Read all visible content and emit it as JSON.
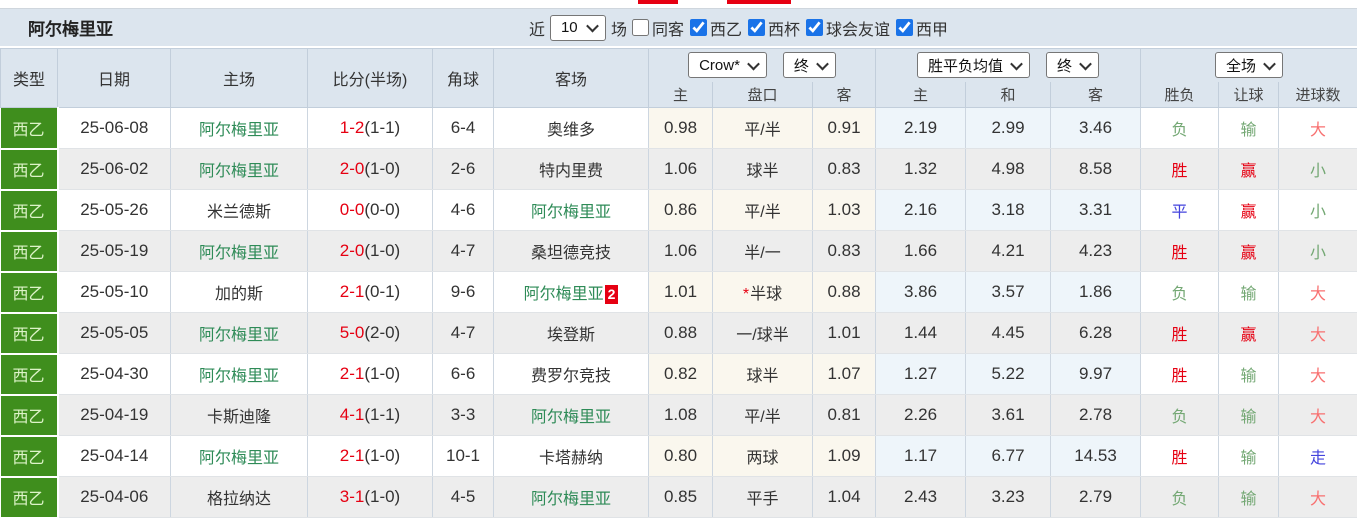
{
  "palette": {
    "strong-red": "#e60012",
    "light-red": "#f87070",
    "soft-green": "#74a874",
    "team-green": "#2e8b57",
    "blue": "#4343dd",
    "type-green": "#3f8e1d",
    "type-text": "#ddf3c8",
    "panel-bg": "#dce5ee",
    "cream": "#faf7ee",
    "lightblue": "#eef5fa",
    "stripe": "#ededed"
  },
  "header": {
    "team_title": "阿尔梅里亚"
  },
  "filter_bar": {
    "recent_label": "近",
    "recent_value": "10",
    "matches_label": "场",
    "checkboxes": [
      {
        "label": "同客",
        "checked": false
      },
      {
        "label": "西乙",
        "checked": true
      },
      {
        "label": "西杯",
        "checked": true
      },
      {
        "label": "球会友谊",
        "checked": true
      },
      {
        "label": "西甲",
        "checked": true
      }
    ]
  },
  "table": {
    "columns": [
      "类型",
      "日期",
      "主场",
      "比分(半场)",
      "角球",
      "客场"
    ],
    "selects": {
      "odds_company": "Crow*",
      "odds_time": "终",
      "avg_type": "胜平负均值",
      "avg_time": "终",
      "scope": "全场"
    },
    "sub_headers": [
      "主",
      "盘口",
      "客",
      "主",
      "和",
      "客",
      "胜负",
      "让球",
      "进球数"
    ],
    "rows": [
      {
        "type": "西乙",
        "date": "25-06-08",
        "home": "阿尔梅里亚",
        "home_team": true,
        "score": "1-2",
        "half": "(1-1)",
        "corner": "6-4",
        "away": "奥维多",
        "away_team": false,
        "away_badge": "",
        "o_home": "0.98",
        "line": "平/半",
        "line_star": false,
        "o_away": "0.91",
        "a_home": "2.19",
        "a_draw": "2.99",
        "a_away": "3.46",
        "res": "负",
        "res_c": "green",
        "let": "输",
        "let_c": "green",
        "goal": "大",
        "goal_c": "lred"
      },
      {
        "type": "西乙",
        "date": "25-06-02",
        "home": "阿尔梅里亚",
        "home_team": true,
        "score": "2-0",
        "half": "(1-0)",
        "corner": "2-6",
        "away": "特内里费",
        "away_team": false,
        "away_badge": "",
        "o_home": "1.06",
        "line": "球半",
        "line_star": false,
        "o_away": "0.83",
        "a_home": "1.32",
        "a_draw": "4.98",
        "a_away": "8.58",
        "res": "胜",
        "res_c": "red",
        "let": "赢",
        "let_c": "red",
        "goal": "小",
        "goal_c": "green"
      },
      {
        "type": "西乙",
        "date": "25-05-26",
        "home": "米兰德斯",
        "home_team": false,
        "score": "0-0",
        "half": "(0-0)",
        "corner": "4-6",
        "away": "阿尔梅里亚",
        "away_team": true,
        "away_badge": "",
        "o_home": "0.86",
        "line": "平/半",
        "line_star": false,
        "o_away": "1.03",
        "a_home": "2.16",
        "a_draw": "3.18",
        "a_away": "3.31",
        "res": "平",
        "res_c": "blue",
        "let": "赢",
        "let_c": "red",
        "goal": "小",
        "goal_c": "green"
      },
      {
        "type": "西乙",
        "date": "25-05-19",
        "home": "阿尔梅里亚",
        "home_team": true,
        "score": "2-0",
        "half": "(1-0)",
        "corner": "4-7",
        "away": "桑坦德竞技",
        "away_team": false,
        "away_badge": "",
        "o_home": "1.06",
        "line": "半/一",
        "line_star": false,
        "o_away": "0.83",
        "a_home": "1.66",
        "a_draw": "4.21",
        "a_away": "4.23",
        "res": "胜",
        "res_c": "red",
        "let": "赢",
        "let_c": "red",
        "goal": "小",
        "goal_c": "green"
      },
      {
        "type": "西乙",
        "date": "25-05-10",
        "home": "加的斯",
        "home_team": false,
        "score": "2-1",
        "half": "(0-1)",
        "corner": "9-6",
        "away": "阿尔梅里亚",
        "away_team": true,
        "away_badge": "2",
        "o_home": "1.01",
        "line": "半球",
        "line_star": true,
        "o_away": "0.88",
        "a_home": "3.86",
        "a_draw": "3.57",
        "a_away": "1.86",
        "res": "负",
        "res_c": "green",
        "let": "输",
        "let_c": "green",
        "goal": "大",
        "goal_c": "lred"
      },
      {
        "type": "西乙",
        "date": "25-05-05",
        "home": "阿尔梅里亚",
        "home_team": true,
        "score": "5-0",
        "half": "(2-0)",
        "corner": "4-7",
        "away": "埃登斯",
        "away_team": false,
        "away_badge": "",
        "o_home": "0.88",
        "line": "一/球半",
        "line_star": false,
        "o_away": "1.01",
        "a_home": "1.44",
        "a_draw": "4.45",
        "a_away": "6.28",
        "res": "胜",
        "res_c": "red",
        "let": "赢",
        "let_c": "red",
        "goal": "大",
        "goal_c": "lred"
      },
      {
        "type": "西乙",
        "date": "25-04-30",
        "home": "阿尔梅里亚",
        "home_team": true,
        "score": "2-1",
        "half": "(1-0)",
        "corner": "6-6",
        "away": "费罗尔竞技",
        "away_team": false,
        "away_badge": "",
        "o_home": "0.82",
        "line": "球半",
        "line_star": false,
        "o_away": "1.07",
        "a_home": "1.27",
        "a_draw": "5.22",
        "a_away": "9.97",
        "res": "胜",
        "res_c": "red",
        "let": "输",
        "let_c": "green",
        "goal": "大",
        "goal_c": "lred"
      },
      {
        "type": "西乙",
        "date": "25-04-19",
        "home": "卡斯迪隆",
        "home_team": false,
        "score": "4-1",
        "half": "(1-1)",
        "corner": "3-3",
        "away": "阿尔梅里亚",
        "away_team": true,
        "away_badge": "",
        "o_home": "1.08",
        "line": "平/半",
        "line_star": false,
        "o_away": "0.81",
        "a_home": "2.26",
        "a_draw": "3.61",
        "a_away": "2.78",
        "res": "负",
        "res_c": "green",
        "let": "输",
        "let_c": "green",
        "goal": "大",
        "goal_c": "lred"
      },
      {
        "type": "西乙",
        "date": "25-04-14",
        "home": "阿尔梅里亚",
        "home_team": true,
        "score": "2-1",
        "half": "(1-0)",
        "corner": "10-1",
        "away": "卡塔赫纳",
        "away_team": false,
        "away_badge": "",
        "o_home": "0.80",
        "line": "两球",
        "line_star": false,
        "o_away": "1.09",
        "a_home": "1.17",
        "a_draw": "6.77",
        "a_away": "14.53",
        "res": "胜",
        "res_c": "red",
        "let": "输",
        "let_c": "green",
        "goal": "走",
        "goal_c": "blue"
      },
      {
        "type": "西乙",
        "date": "25-04-06",
        "home": "格拉纳达",
        "home_team": false,
        "score": "3-1",
        "half": "(1-0)",
        "corner": "4-5",
        "away": "阿尔梅里亚",
        "away_team": true,
        "away_badge": "",
        "o_home": "0.85",
        "line": "平手",
        "line_star": false,
        "o_away": "1.04",
        "a_home": "2.43",
        "a_draw": "3.23",
        "a_away": "2.79",
        "res": "负",
        "res_c": "green",
        "let": "输",
        "let_c": "green",
        "goal": "大",
        "goal_c": "lred"
      }
    ]
  }
}
